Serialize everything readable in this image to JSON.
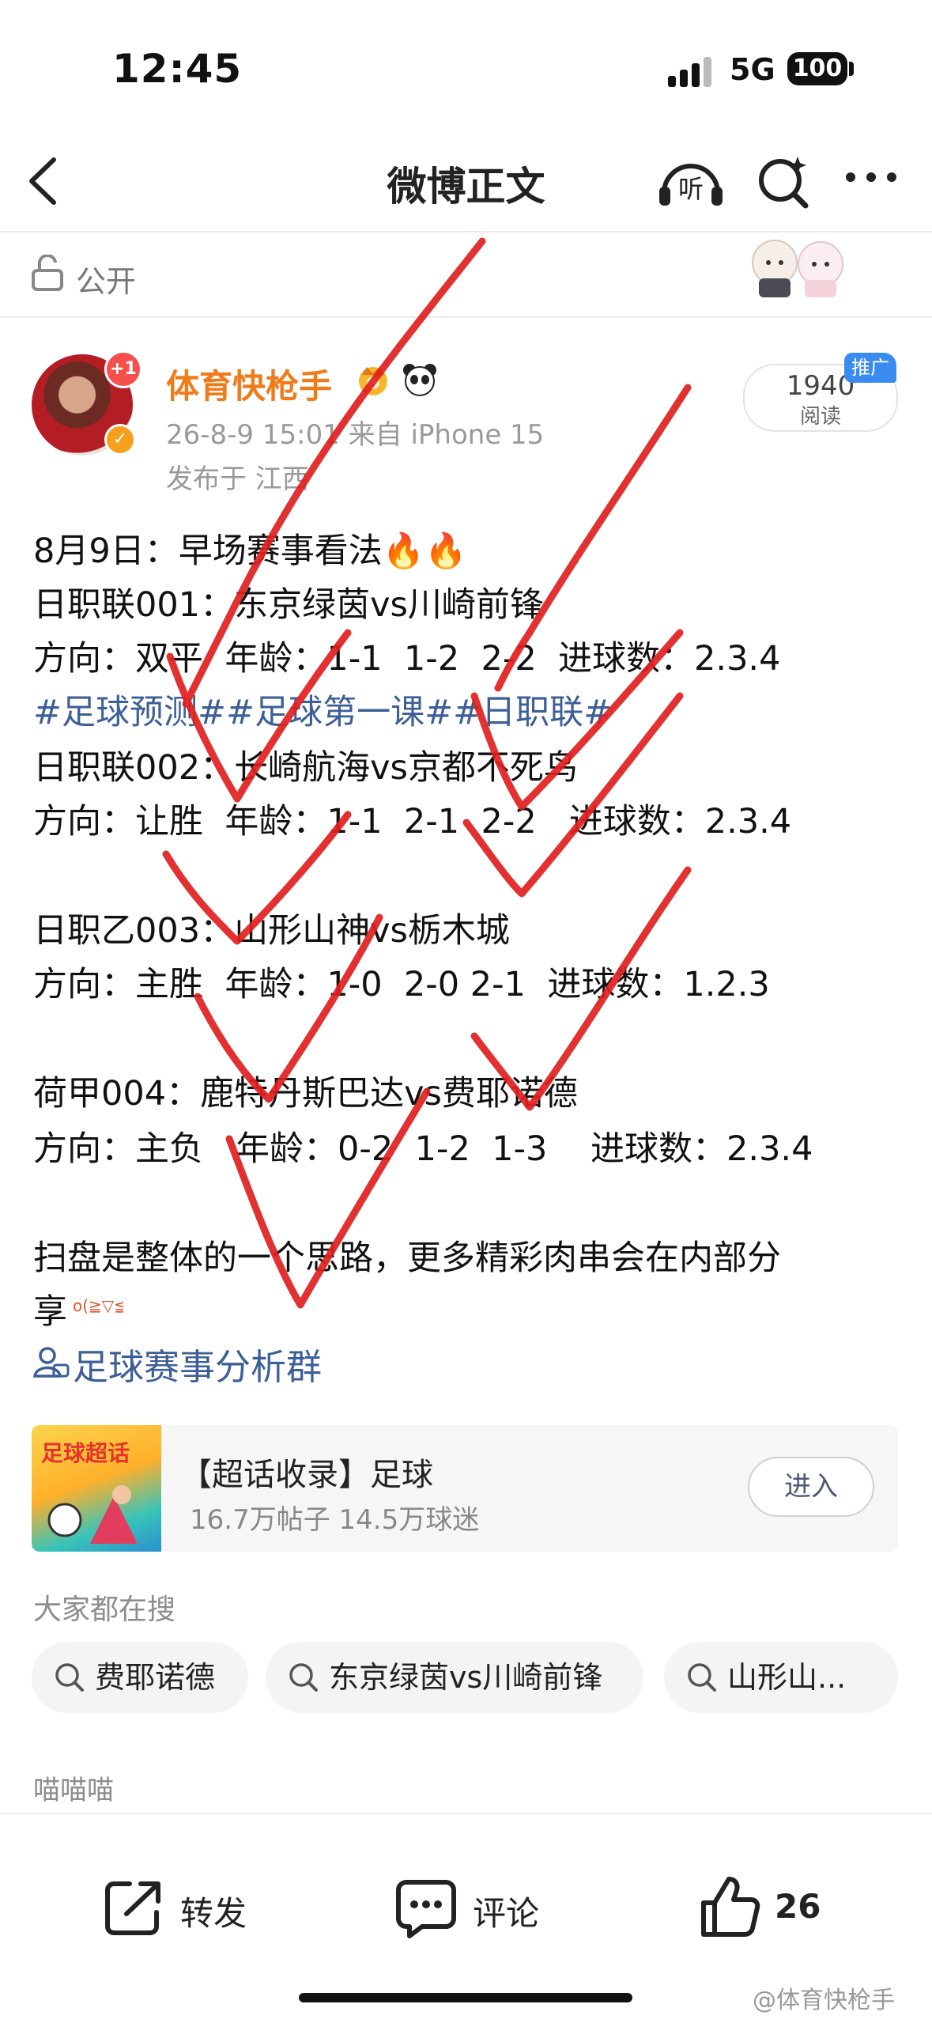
{
  "status_bar": {
    "time": "12:45",
    "network": "5G",
    "battery": "100"
  },
  "nav": {
    "title": "微博正文",
    "listen_label": "听"
  },
  "visibility": {
    "label": "公开"
  },
  "post": {
    "author": "体育快枪手",
    "avatar_badge": "+1",
    "meta_time_source": "26-8-9 15:01 来自 iPhone 15",
    "meta_location": "发布于 江西",
    "reads_count": "1940",
    "reads_label": "阅读",
    "promo_label": "推广",
    "lines": [
      "8月9日：早场赛事看法🔥🔥",
      "日职联001：东京绿茵vs川崎前锋",
      "方向：双平  年龄：1-1  1-2  2-2  进球数：2.3.4",
      "#足球预测##足球第一课##日职联#",
      "日职联002：长崎航海vs京都不死鸟",
      "方向：让胜  年龄：1-1  2-1  2-2   进球数：2.3.4",
      "日职乙003：山形山神vs栃木城",
      "方向：主胜  年龄：1-0  2-0 2-1  进球数：1.2.3",
      "荷甲004：鹿特丹斯巴达vs费耶诺德",
      "方向：主负   年龄：0-2  1-2  1-3    进球数：2.3.4",
      "扫盘是整体的一个思路，更多精彩肉串会在内部分",
      "享"
    ],
    "group_link": "足球赛事分析群"
  },
  "super_topic": {
    "image_text": "足球超话",
    "title": "【超话收录】足球",
    "stats": "16.7万帖子  14.5万球迷",
    "enter_label": "进入"
  },
  "search": {
    "heading": "大家都在搜",
    "chips": [
      "费耶诺德",
      "东京绿茵vs川崎前锋",
      "山形山..."
    ]
  },
  "section_hint": "喵喵喵",
  "bottom_bar": {
    "repost_label": "转发",
    "comment_label": "评论",
    "like_count": "26",
    "watermark": "@体育快枪手"
  },
  "colors": {
    "username": "#f07b1a",
    "link": "#3d5f97",
    "overlay_ink": "#e0201f"
  }
}
